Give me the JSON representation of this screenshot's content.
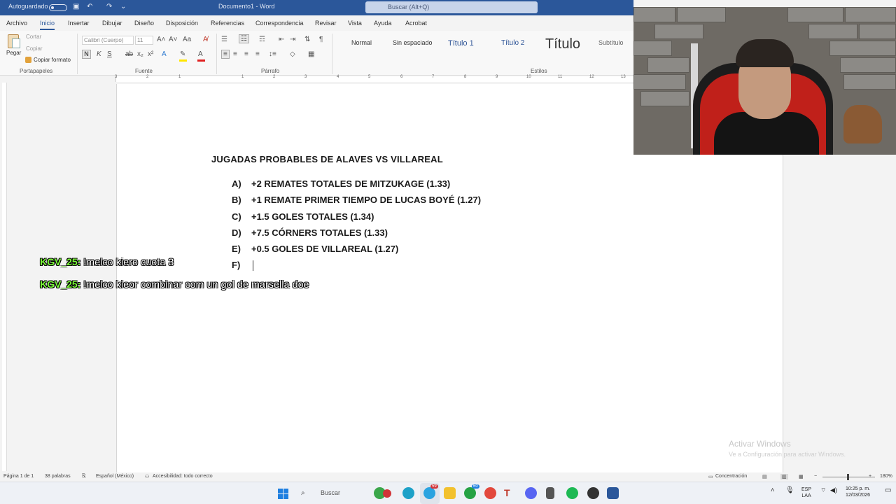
{
  "titlebar": {
    "autosave_label": "Autoguardado",
    "doc_title": "Documento1 - Word",
    "search_placeholder": "Buscar (Alt+Q)"
  },
  "ribbon_tabs": [
    "Archivo",
    "Inicio",
    "Insertar",
    "Dibujar",
    "Diseño",
    "Disposición",
    "Referencias",
    "Correspondencia",
    "Revisar",
    "Vista",
    "Ayuda",
    "Acrobat"
  ],
  "ribbon": {
    "clipboard": {
      "paste": "Pegar",
      "cut": "Cortar",
      "copy": "Copiar",
      "format_painter": "Copiar formato",
      "label": "Portapapeles"
    },
    "font": {
      "font_name": "Calibri (Cuerpo)",
      "font_size": "11",
      "label": "Fuente",
      "bold": "N",
      "italic": "K",
      "underline": "S"
    },
    "paragraph": {
      "label": "Párrafo"
    },
    "styles": {
      "label": "Estilos",
      "items": [
        "Normal",
        "Sin espaciado",
        "Título 1",
        "Título 2",
        "Título",
        "Subtítulo"
      ]
    }
  },
  "ruler_numbers": [
    "3",
    "2",
    "1",
    "1",
    "2",
    "3",
    "4",
    "5",
    "6",
    "7",
    "8",
    "9",
    "10",
    "11",
    "12",
    "13"
  ],
  "document": {
    "heading": "JUGADAS PROBABLES DE ALAVES VS VILLAREAL",
    "items": [
      {
        "marker": "A)",
        "text": "+2 REMATES TOTALES DE MITZUKAGE (1.33)"
      },
      {
        "marker": "B)",
        "text": "+1 REMATE PRIMER TIEMPO DE LUCAS BOYÉ (1.27)"
      },
      {
        "marker": "C)",
        "text": "+1.5 GOLES TOTALES (1.34)"
      },
      {
        "marker": "D)",
        "text": "+7.5 CÓRNERS TOTALES (1.33)"
      },
      {
        "marker": "E)",
        "text": "+0.5 GOLES DE VILLAREAL (1.27)"
      },
      {
        "marker": "F)",
        "text": ""
      }
    ]
  },
  "chat": [
    {
      "user": "KGV_25:",
      "message": "!melco kiero cuota 3"
    },
    {
      "user": "KGV_25:",
      "message": "!melco kieor combinar com un gol de marsella doe"
    }
  ],
  "statusbar": {
    "page": "Página 1 de 1",
    "words": "38 palabras",
    "language": "Español (México)",
    "accessibility": "Accesibilidad: todo correcto",
    "focus": "Concentración",
    "zoom": "180%"
  },
  "watermark": {
    "line1": "Activar Windows",
    "line2": "Ve a Configuración para activar Windows."
  },
  "taskbar": {
    "search_placeholder": "Buscar",
    "badge_telegram": "59",
    "badge_whatsapp": "60",
    "lang": "ESP",
    "region": "LAA",
    "time": "10:25 p. m.",
    "date": "12/03/2026"
  }
}
